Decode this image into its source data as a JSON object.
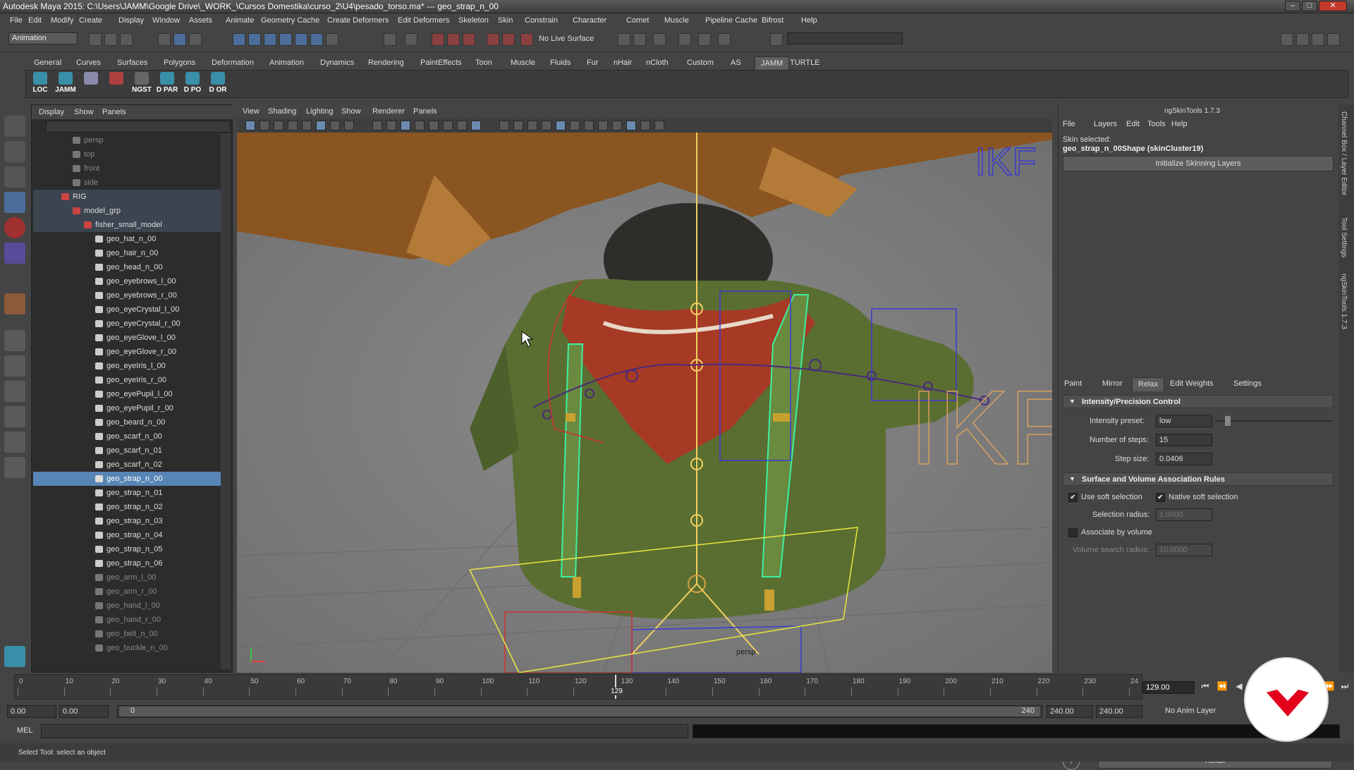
{
  "window": {
    "title": "Autodesk Maya 2015: C:\\Users\\JAMM\\Google Drive\\_WORK_\\Cursos Domestika\\curso_2\\U4\\pesado_torso.ma*   ---   geo_strap_n_00",
    "minimize": "–",
    "maximize": "□",
    "close": "✕"
  },
  "menubar": [
    "File",
    "Edit",
    "Modify",
    "Create",
    "Display",
    "Window",
    "Assets",
    "Animate",
    "Geometry Cache",
    "Create Deformers",
    "Edit Deformers",
    "Skeleton",
    "Skin",
    "Constrain",
    "Character",
    "Comet",
    "Muscle",
    "Pipeline Cache",
    "Bifrost",
    "Help"
  ],
  "statusline": {
    "mode": "Animation",
    "live_surface": "No Live Surface"
  },
  "shelf": {
    "tabs": [
      "General",
      "Curves",
      "Surfaces",
      "Polygons",
      "Deformation",
      "Animation",
      "Dynamics",
      "Rendering",
      "PaintEffects",
      "Toon",
      "Muscle",
      "Fluids",
      "Fur",
      "nHair",
      "nCloth",
      "Custom",
      "AS",
      "JAMM",
      "TURTLE"
    ],
    "active_tab": "JAMM",
    "buttons": [
      {
        "label": "LOC",
        "color": "#3a8fa8"
      },
      {
        "label": "JAMM",
        "color": "#3a8fa8"
      },
      {
        "label": "",
        "color": "#8a8aaa"
      },
      {
        "label": "",
        "color": "#b04040"
      },
      {
        "label": "NGST",
        "color": "#666666"
      },
      {
        "label": "D PAR",
        "color": "#3a8fa8"
      },
      {
        "label": "D PO",
        "color": "#3a8fa8"
      },
      {
        "label": "D OR",
        "color": "#3a8fa8"
      }
    ]
  },
  "outliner": {
    "menu": [
      "Display",
      "Show",
      "Panels"
    ],
    "rows": [
      {
        "label": "persp",
        "indent": 1,
        "style": "dim"
      },
      {
        "label": "top",
        "indent": 1,
        "style": "dim"
      },
      {
        "label": "front",
        "indent": 1,
        "style": "dim"
      },
      {
        "label": "side",
        "indent": 1,
        "style": "dim"
      },
      {
        "label": "RIG",
        "indent": 0,
        "style": "grp"
      },
      {
        "label": "model_grp",
        "indent": 1,
        "style": "grp"
      },
      {
        "label": "fisher_small_model",
        "indent": 2,
        "style": "grp"
      },
      {
        "label": "geo_hat_n_00",
        "indent": 3,
        "style": ""
      },
      {
        "label": "geo_hair_n_00",
        "indent": 3,
        "style": ""
      },
      {
        "label": "geo_head_n_00",
        "indent": 3,
        "style": ""
      },
      {
        "label": "geo_eyebrows_l_00",
        "indent": 3,
        "style": ""
      },
      {
        "label": "geo_eyebrows_r_00",
        "indent": 3,
        "style": ""
      },
      {
        "label": "geo_eyeCrystal_l_00",
        "indent": 3,
        "style": ""
      },
      {
        "label": "geo_eyeCrystal_r_00",
        "indent": 3,
        "style": ""
      },
      {
        "label": "geo_eyeGlove_l_00",
        "indent": 3,
        "style": ""
      },
      {
        "label": "geo_eyeGlove_r_00",
        "indent": 3,
        "style": ""
      },
      {
        "label": "geo_eyeIris_l_00",
        "indent": 3,
        "style": ""
      },
      {
        "label": "geo_eyeIris_r_00",
        "indent": 3,
        "style": ""
      },
      {
        "label": "geo_eyePupil_l_00",
        "indent": 3,
        "style": ""
      },
      {
        "label": "geo_eyePupil_r_00",
        "indent": 3,
        "style": ""
      },
      {
        "label": "geo_beard_n_00",
        "indent": 3,
        "style": ""
      },
      {
        "label": "geo_scarf_n_00",
        "indent": 3,
        "style": ""
      },
      {
        "label": "geo_scarf_n_01",
        "indent": 3,
        "style": ""
      },
      {
        "label": "geo_scarf_n_02",
        "indent": 3,
        "style": ""
      },
      {
        "label": "geo_strap_n_00",
        "indent": 3,
        "style": "sel"
      },
      {
        "label": "geo_strap_n_01",
        "indent": 3,
        "style": ""
      },
      {
        "label": "geo_strap_n_02",
        "indent": 3,
        "style": ""
      },
      {
        "label": "geo_strap_n_03",
        "indent": 3,
        "style": ""
      },
      {
        "label": "geo_strap_n_04",
        "indent": 3,
        "style": ""
      },
      {
        "label": "geo_strap_n_05",
        "indent": 3,
        "style": ""
      },
      {
        "label": "geo_strap_n_06",
        "indent": 3,
        "style": ""
      },
      {
        "label": "geo_arm_l_00",
        "indent": 3,
        "style": "dim"
      },
      {
        "label": "geo_arm_r_00",
        "indent": 3,
        "style": "dim"
      },
      {
        "label": "geo_hand_l_00",
        "indent": 3,
        "style": "dim"
      },
      {
        "label": "geo_hand_r_00",
        "indent": 3,
        "style": "dim"
      },
      {
        "label": "geo_belt_n_00",
        "indent": 3,
        "style": "dim"
      },
      {
        "label": "geo_buckle_n_00",
        "indent": 3,
        "style": "dim"
      }
    ]
  },
  "viewport": {
    "menu": [
      "View",
      "Shading",
      "Lighting",
      "Show",
      "Renderer",
      "Panels"
    ],
    "camera_label": "persp",
    "watermark_top": "IKF",
    "watermark_bottom": "IKF"
  },
  "skintools": {
    "title": "ngSkinTools 1.7.3",
    "menu": [
      "File",
      "Layers",
      "Edit",
      "Tools",
      "Help"
    ],
    "skin_selected_label": "Skin selected:",
    "skin_selected_value": "geo_strap_n_00Shape (skinCluster19)",
    "init_button": "Initialize Skinning Layers",
    "tabs": [
      "Paint",
      "Mirror",
      "Relax",
      "Edit Weights",
      "Settings"
    ],
    "active_tab": "Relax",
    "section1": "Intensity/Precision Control",
    "intensity_label": "Intensity preset:",
    "intensity_value": "low",
    "steps_label": "Number of steps:",
    "steps_value": "15",
    "stepsize_label": "Step size:",
    "stepsize_value": "0.0406",
    "section2": "Surface and Volume Association Rules",
    "use_soft_label": "Use soft selection",
    "use_soft": true,
    "native_soft_label": "Native soft selection",
    "native_soft": true,
    "sel_radius_label": "Selection radius:",
    "sel_radius_value": "1.0000",
    "assoc_volume_label": "Associate by volume",
    "assoc_volume": false,
    "vol_radius_label": "Volume search radius:",
    "vol_radius_value": "10.0000",
    "help_button": "?",
    "relax_button": "Relax"
  },
  "side_tabs": [
    "Channel Box / Layer Editor",
    "Tool Settings",
    "ngSkinTools 1.7.3"
  ],
  "timeline": {
    "ticks": [
      "0",
      "10",
      "20",
      "30",
      "40",
      "50",
      "60",
      "70",
      "80",
      "90",
      "100",
      "110",
      "120",
      "130",
      "140",
      "150",
      "160",
      "170",
      "180",
      "190",
      "200",
      "210",
      "220",
      "230",
      "24"
    ],
    "current_tick_label": "129",
    "current_frame_value": 129,
    "current_frame": "129.00"
  },
  "range": {
    "start": "0.00",
    "inner_start": "0.00",
    "slider_start": "0",
    "slider_end": "240",
    "inner_end": "240.00",
    "end": "240.00",
    "anim_layer": "No Anim Layer"
  },
  "cmdline": {
    "label": "MEL"
  },
  "helpline": {
    "text": "Select Tool: select an object"
  }
}
